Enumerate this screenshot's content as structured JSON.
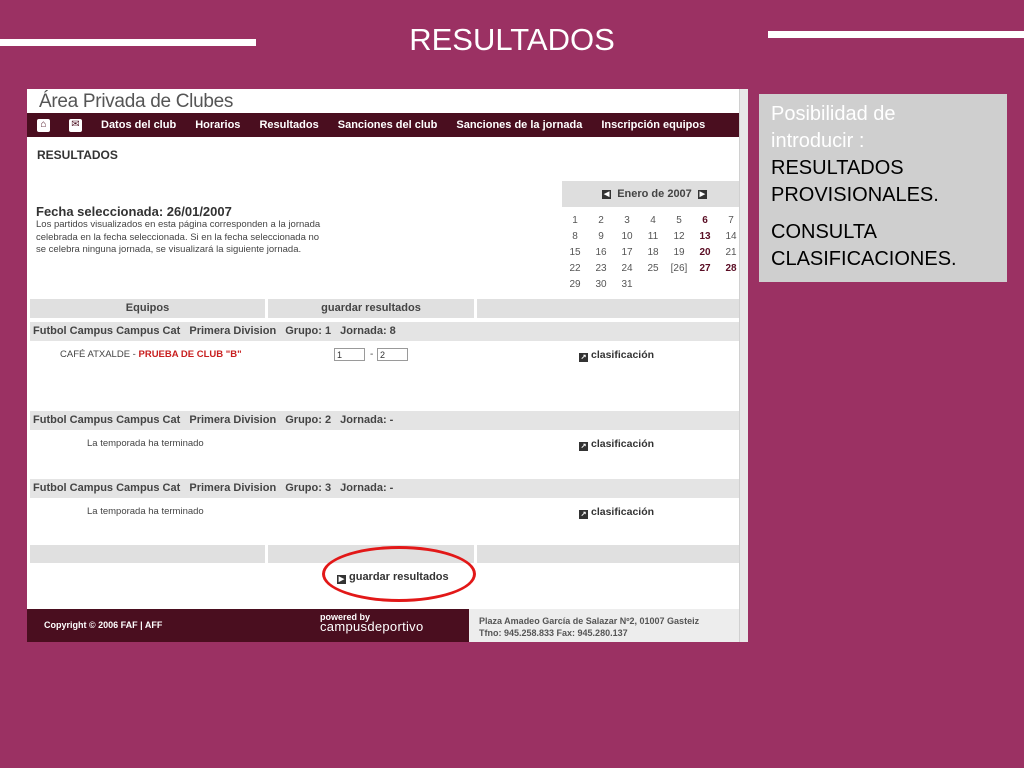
{
  "slide": {
    "title": "RESULTADOS"
  },
  "colors": {
    "slide_bg": "#9b3163",
    "nav_bg": "#4a0e1f",
    "highlight": "#e21818"
  },
  "app": {
    "brand": "Área Privada de Clubes",
    "nav_icons": [
      "home-icon",
      "mail-icon"
    ],
    "nav_links": [
      "Datos del club",
      "Horarios",
      "Resultados",
      "Sanciones del club",
      "Sanciones de la jornada",
      "Inscripción equipos"
    ]
  },
  "page": {
    "section_title": "RESULTADOS",
    "fecha_title": "Fecha seleccionada: 26/01/2007",
    "fecha_desc": "Los partidos visualizados en esta página corresponden a la jornada celebrada en la fecha seleccionada. Si en la fecha seleccionada no se celebra ninguna jornada, se visualizará la siguiente jornada."
  },
  "calendar": {
    "month": "Enero de 2007",
    "weeks": [
      [
        "1",
        "2",
        "3",
        "4",
        "5",
        "6",
        "7"
      ],
      [
        "8",
        "9",
        "10",
        "11",
        "12",
        "13",
        "14"
      ],
      [
        "15",
        "16",
        "17",
        "18",
        "19",
        "20",
        "21"
      ],
      [
        "22",
        "23",
        "24",
        "25",
        "[26]",
        "27",
        "28"
      ],
      [
        "29",
        "30",
        "31",
        "",
        "",
        "",
        ""
      ]
    ]
  },
  "table": {
    "head_equipos": "Equipos",
    "head_guardar": "guardar resultados",
    "groups": [
      {
        "comp": "Futbol Campus Campus Cat",
        "division": "Primera Division",
        "grupo": "Grupo: 1",
        "jornada": "Jornada: 8"
      },
      {
        "comp": "Futbol Campus Campus Cat",
        "division": "Primera Division",
        "grupo": "Grupo: 2",
        "jornada": "Jornada: -"
      },
      {
        "comp": "Futbol Campus Campus Cat",
        "division": "Primera Division",
        "grupo": "Grupo: 3",
        "jornada": "Jornada: -"
      }
    ],
    "match": {
      "home": "CAFÉ ATXALDE",
      "sep": " - ",
      "away": "PRUEBA DE CLUB \"B\"",
      "score_home": "1",
      "score_away": "2",
      "dash": "-"
    },
    "terminado": "La temporada ha terminado",
    "clasificacion": "clasificación",
    "save_button": "guardar resultados"
  },
  "footer": {
    "copyright": "Copyright © 2006 FAF | AFF",
    "powered_by": "powered by",
    "powered_brand": "campusdeportivo",
    "address": "Plaza Amadeo García de Salazar Nº2, 01007 Gasteiz",
    "phone": "Tfno: 945.258.833 Fax: 945.280.137"
  },
  "info": {
    "line1": "Posibilidad de",
    "line2": "introducir :",
    "line3": "RESULTADOS",
    "line4": "PROVISIONALES.",
    "line5": "CONSULTA",
    "line6": "CLASIFICACIONES."
  }
}
